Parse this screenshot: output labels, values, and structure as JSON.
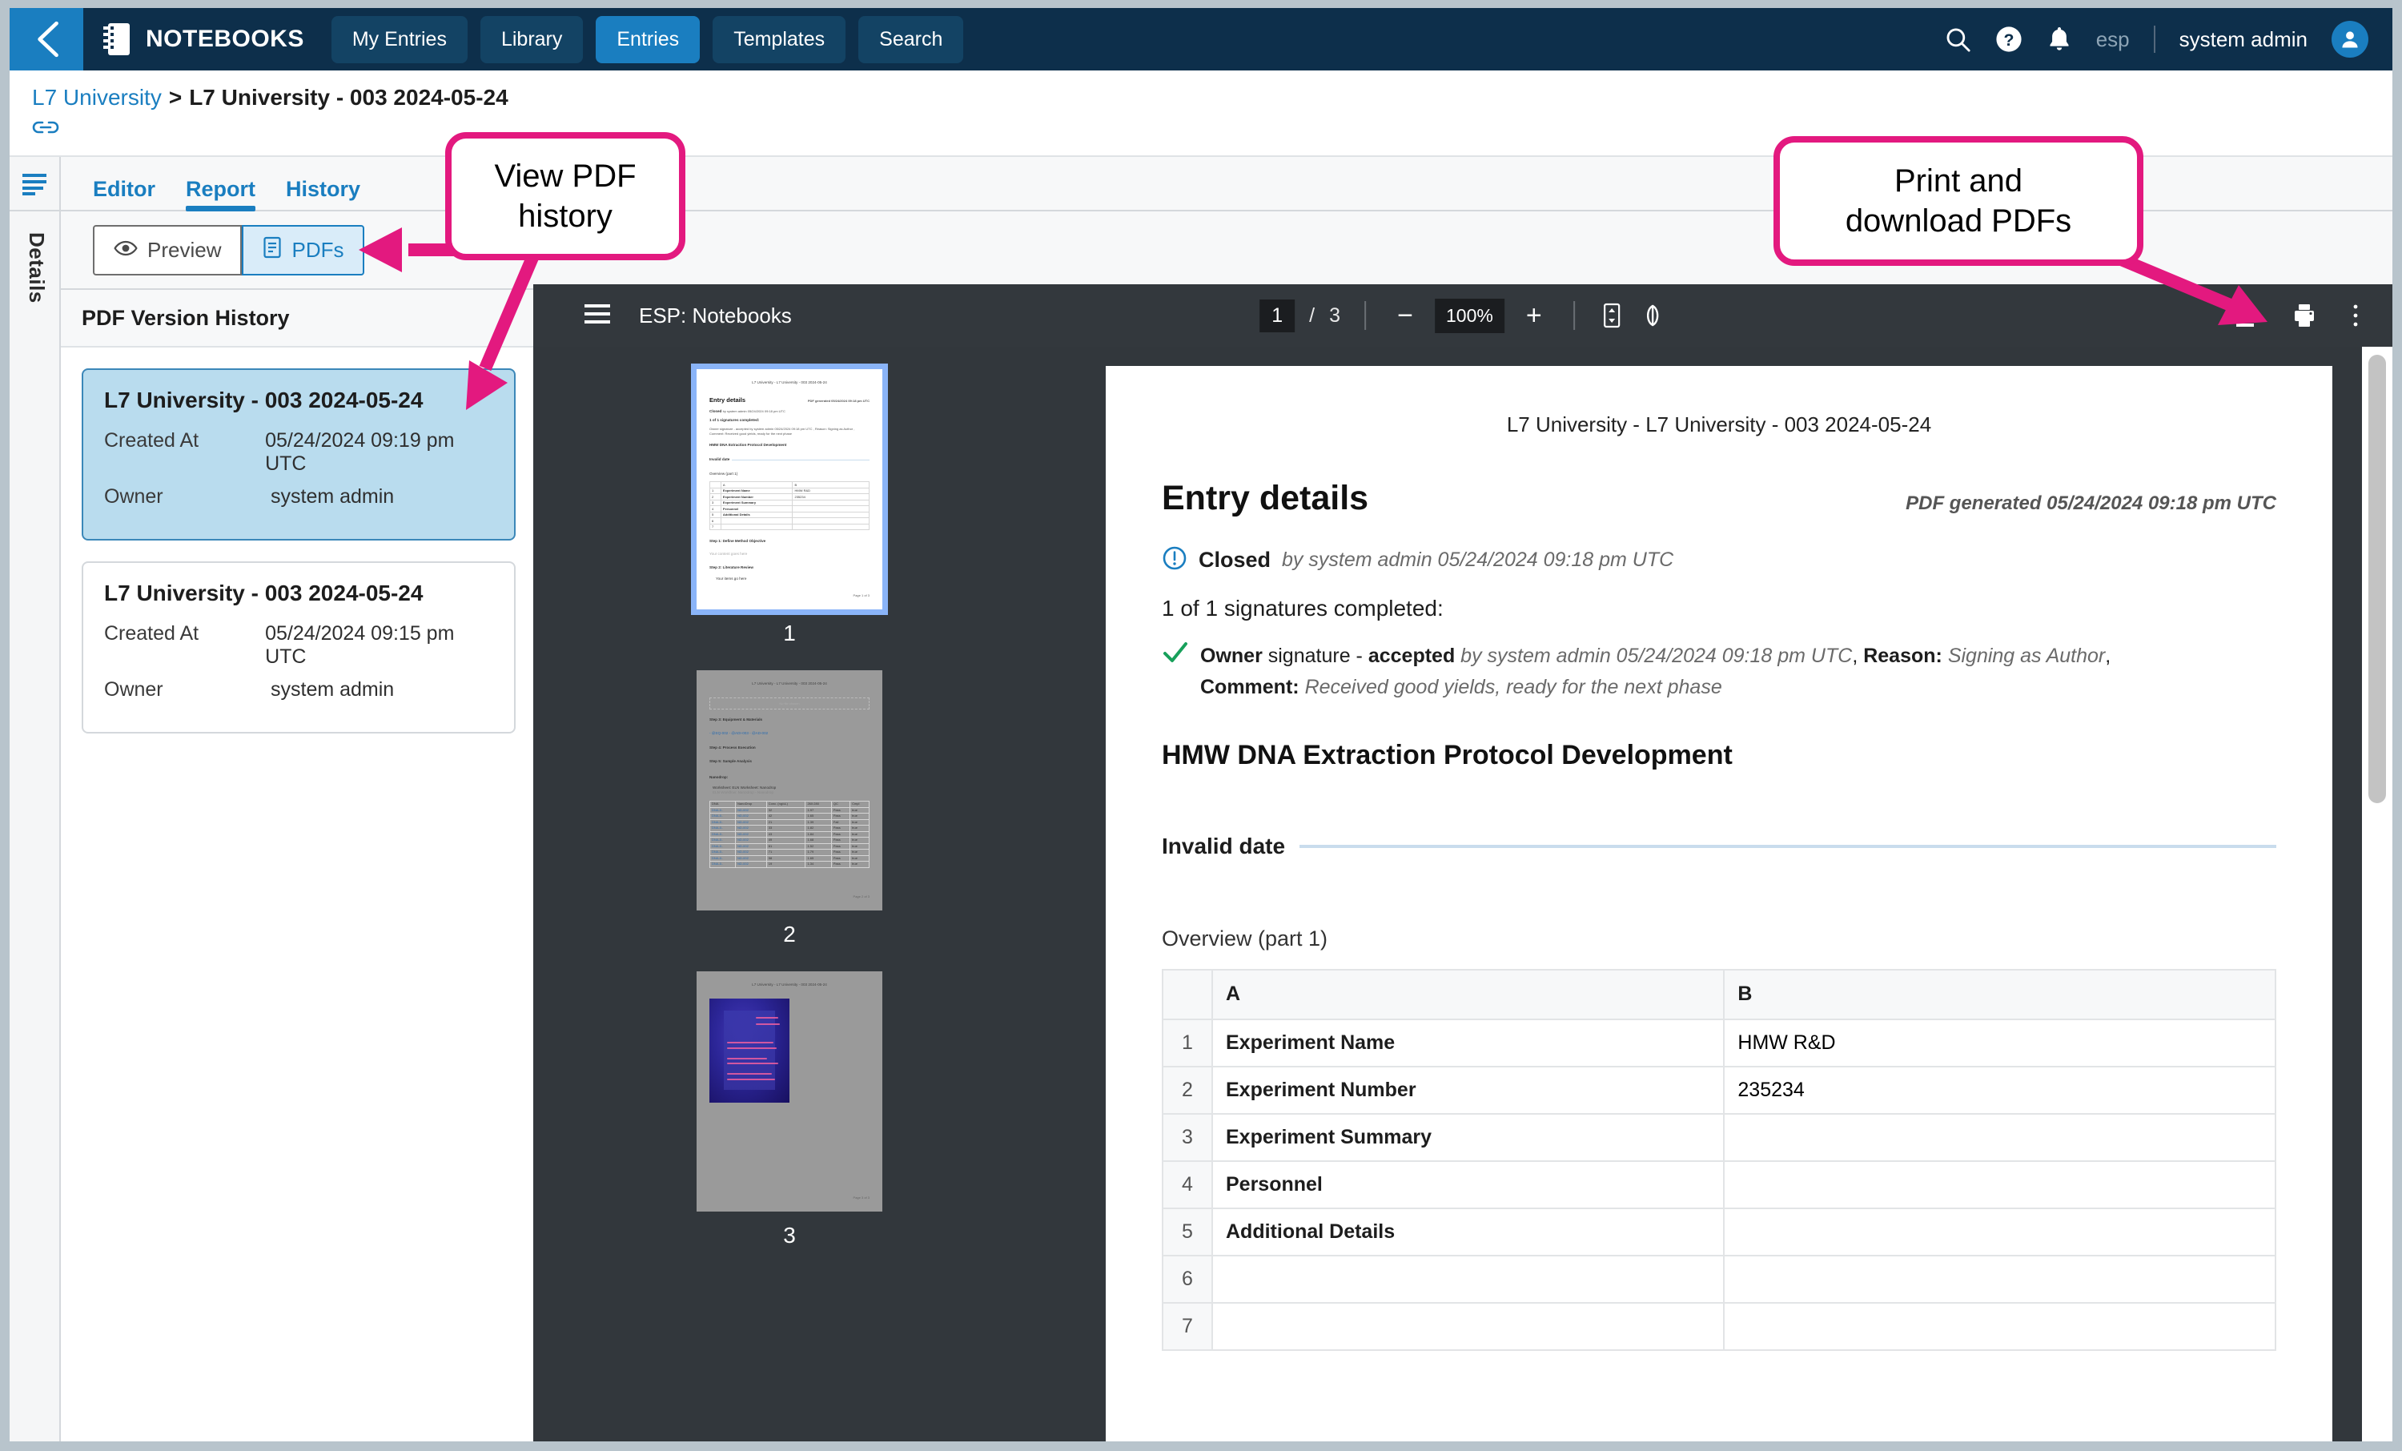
{
  "topnav": {
    "back_label": "back",
    "brand": "NOTEBOOKS",
    "items": [
      {
        "label": "My Entries",
        "active": false
      },
      {
        "label": "Library",
        "active": false
      },
      {
        "label": "Entries",
        "active": true
      },
      {
        "label": "Templates",
        "active": false
      },
      {
        "label": "Search",
        "active": false
      }
    ],
    "lang": "esp",
    "user": "system admin",
    "icons": [
      "search-icon",
      "help-icon",
      "notifications-icon",
      "avatar-icon"
    ],
    "colors": {
      "bar": "#0d2f4b",
      "accent": "#1a7ec0"
    }
  },
  "breadcrumb": {
    "parent": "L7 University",
    "separator": ">",
    "current": "L7 University - 003 2024-05-24"
  },
  "rail": {
    "label": "Details"
  },
  "tabs": [
    {
      "label": "Editor",
      "active": false
    },
    {
      "label": "Report",
      "active": true
    },
    {
      "label": "History",
      "active": false
    }
  ],
  "subtoolbar": {
    "preview_label": "Preview",
    "pdfs_label": "PDFs",
    "active": "PDFs"
  },
  "history": {
    "title": "PDF Version History",
    "created_label": "Created At",
    "owner_label": "Owner",
    "versions": [
      {
        "title": "L7 University - 003 2024-05-24",
        "created_at": "05/24/2024 09:19 pm UTC",
        "owner": "system admin",
        "selected": true
      },
      {
        "title": "L7 University - 003 2024-05-24",
        "created_at": "05/24/2024 09:15 pm UTC",
        "owner": "system admin",
        "selected": false
      }
    ]
  },
  "pdf_viewer": {
    "title": "ESP: Notebooks",
    "current_page": "1",
    "page_separator": "/",
    "total_pages": "3",
    "zoom": "100%",
    "zoom_out_label": "−",
    "zoom_in_label": "+",
    "fit_label": "fit-page-icon",
    "rotate_label": "rotate-icon",
    "download_label": "download-icon",
    "print_label": "print-icon",
    "more_label": "more-options-icon",
    "thumbnails": [
      {
        "number": "1",
        "selected": true
      },
      {
        "number": "2",
        "selected": false
      },
      {
        "number": "3",
        "selected": false
      }
    ]
  },
  "document": {
    "running_head": "L7 University - L7 University - 003 2024-05-24",
    "heading": "Entry details",
    "generated": "PDF generated 05/24/2024 09:18 pm UTC",
    "status": "Closed",
    "status_by": "by system admin 05/24/2024 09:18 pm UTC",
    "signature_summary": "1 of 1 signatures completed:",
    "signature": {
      "role": "Owner",
      "word": "signature -",
      "state": "accepted",
      "by": "by system admin 05/24/2024 09:18 pm UTC",
      "comma": ",",
      "reason_label": "Reason:",
      "reason": "Signing as Author",
      "comment_label": "Comment:",
      "comment": "Received good yields, ready for the next phase"
    },
    "protocol_title": "HMW DNA Extraction Protocol Development",
    "date_label": "Invalid date",
    "overview_label": "Overview (part 1)",
    "table": {
      "columns": [
        "",
        "A",
        "B"
      ],
      "rows": [
        {
          "idx": "1",
          "a": "Experiment Name",
          "b": "HMW R&D"
        },
        {
          "idx": "2",
          "a": "Experiment Number",
          "b": "235234"
        },
        {
          "idx": "3",
          "a": "Experiment Summary",
          "b": ""
        },
        {
          "idx": "4",
          "a": "Personnel",
          "b": ""
        },
        {
          "idx": "5",
          "a": "Additional Details",
          "b": ""
        },
        {
          "idx": "6",
          "a": "",
          "b": ""
        },
        {
          "idx": "7",
          "a": "",
          "b": ""
        }
      ]
    }
  },
  "thumb_page1": {
    "head": "L7 University - L7 University - 003 2024-05-24",
    "h1": "Entry details",
    "gen": "PDF generated 05/24/2024 09:18 pm UTC",
    "closed": "Closed",
    "closed_by": "by system admin 05/24/2024 09:18 pm UTC",
    "sigs": "1 of 1 signatures completed:",
    "sig_line": "Owner  signature - accepted by system admin 05/24/2024 09:18 pm UTC , Reason: Signing as Author ,",
    "comment_line": "Comment: Received good yields, ready for the next phase",
    "protocol": "HMW DNA Extraction Protocol Development",
    "date": "Invalid date",
    "overview": "Overview (part 1)",
    "step1": "Step 1: Define Method Objective",
    "step1_body": "Your content goes here",
    "step2": "Step 2: Literature Review",
    "step2_bullet": "Your items go here",
    "footer": "Page 1 of 3"
  },
  "thumb_page2": {
    "head": "L7 University - L7 University - 003 2024-05-24",
    "nofile": "No file chosen",
    "step3": "Step 3: Equipment & Materials",
    "links": "- @EQ-002 - @ADI-003 - @AD-002",
    "step4": "Step 4: Process Execution",
    "step5": "Step 5: Sample Analysis",
    "nanodrop": "Nanodrop:",
    "worksheet": "Worksheet: ELN Worksheet: Nanodrop",
    "eln": "ELN Workflow: Nanodrop - Nanodrop",
    "columns": [
      "DNA",
      "NanoDrop",
      "Concentration (ng/uL)",
      "260:280 Ratio",
      "QC Results",
      "Complete"
    ],
    "rows": [
      [
        "DNA-0...",
        "ND-002",
        "32",
        "1.97",
        "Pass",
        "true"
      ],
      [
        "DNA-0...",
        "ND-002",
        "42",
        "1.65",
        "Pass",
        "true"
      ],
      [
        "DNA-0...",
        "ND-002",
        "21",
        "1.39",
        "Fail",
        "true"
      ],
      [
        "DNA-0...",
        "ND-002",
        "33",
        "1.82",
        "Pass",
        "true"
      ],
      [
        "DNA-0...",
        "ND-002",
        "43",
        "1.84",
        "Pass",
        "true"
      ],
      [
        "DNA-0...",
        "ND-002",
        "49",
        "1.68",
        "Pass",
        "true"
      ],
      [
        "DNA-0...",
        "ND-002",
        "61",
        "1.52",
        "Pass",
        "true"
      ],
      [
        "DNA-0...",
        "ND-002",
        "71",
        "1.79",
        "Pass",
        "true"
      ],
      [
        "DNA-0...",
        "ND-002",
        "58",
        "1.65",
        "Pass",
        "true"
      ],
      [
        "DNA-0...",
        "ND-002",
        "19",
        "1.34",
        "Pass",
        "true"
      ]
    ],
    "footer": "Page 2 of 3"
  },
  "thumb_page3": {
    "head": "L7 University - L7 University - 003 2024-05-24",
    "footer": "Page 3 of 3"
  },
  "callouts": [
    {
      "text": "View PDF\nhistory",
      "line1": "View PDF",
      "line2": "history"
    },
    {
      "text": "Print and\ndownload PDFs",
      "line1": "Print and",
      "line2": "download PDFs"
    }
  ],
  "annotation_color": "#e3197f"
}
